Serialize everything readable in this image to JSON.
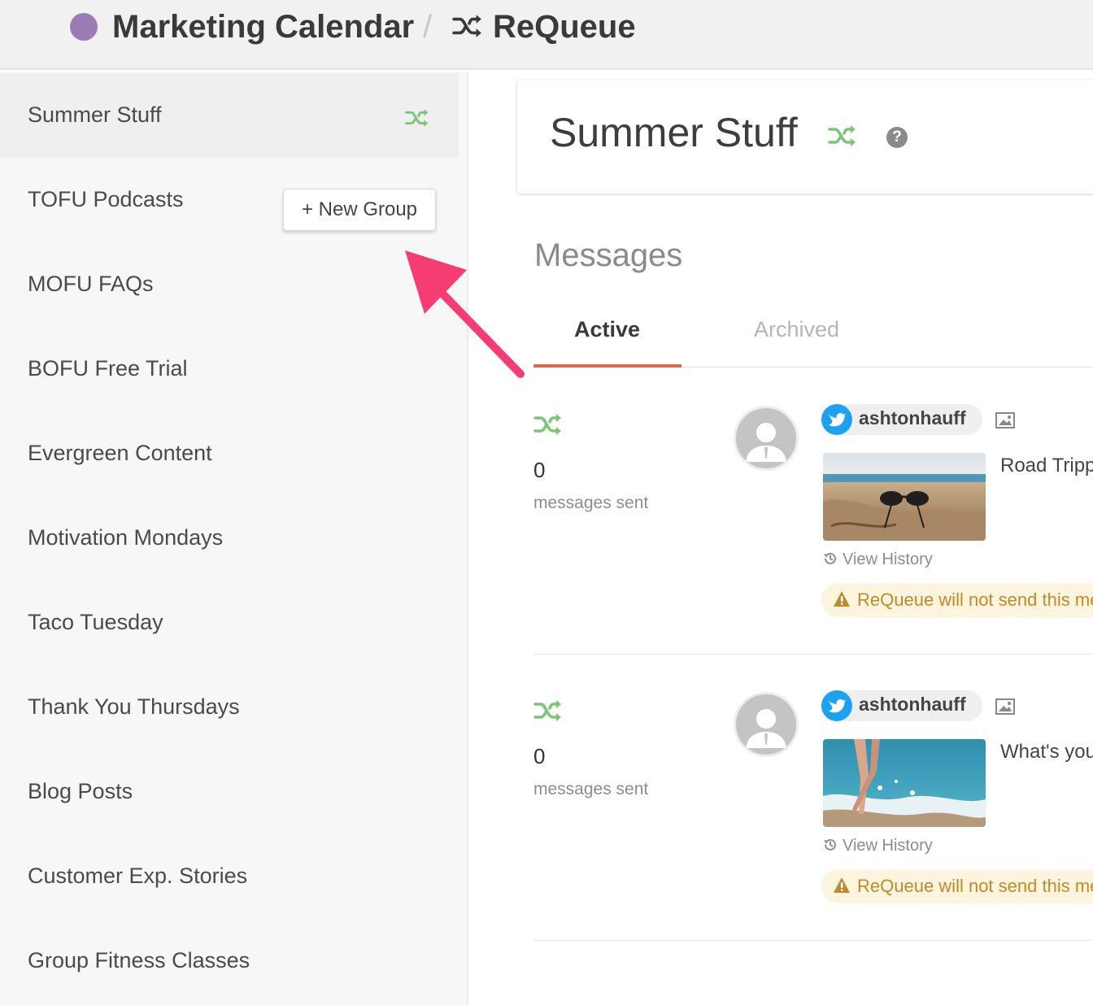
{
  "breadcrumb": {
    "calendar": "Marketing Calendar",
    "separator": "/",
    "section": "ReQueue",
    "dot_color": "#9b7bb1"
  },
  "sidebar": {
    "items": [
      {
        "label": "Summer Stuff",
        "active": true
      },
      {
        "label": "TOFU Podcasts"
      },
      {
        "label": "MOFU FAQs"
      },
      {
        "label": "BOFU Free Trial"
      },
      {
        "label": "Evergreen Content"
      },
      {
        "label": "Motivation Mondays"
      },
      {
        "label": "Taco Tuesday"
      },
      {
        "label": "Thank You Thursdays"
      },
      {
        "label": "Blog Posts"
      },
      {
        "label": "Customer Exp. Stories"
      },
      {
        "label": "Group Fitness Classes"
      }
    ],
    "new_group_label": "+ New Group"
  },
  "main": {
    "title": "Summer Stuff",
    "help": "?",
    "section_title": "Messages",
    "tabs": [
      {
        "label": "Active",
        "active": true
      },
      {
        "label": "Archived"
      }
    ],
    "messages": [
      {
        "count": "0",
        "count_label": "messages sent",
        "username": "ashtonhauff",
        "text": "Road Tripp",
        "history": "View History",
        "warning": "ReQueue will not send this me"
      },
      {
        "count": "0",
        "count_label": "messages sent",
        "username": "ashtonhauff",
        "text": "What's you",
        "history": "View History",
        "warning": "ReQueue will not send this me"
      }
    ]
  },
  "colors": {
    "shuffle_green": "#7cc576",
    "tab_underline": "#d86b4d",
    "arrow_pink": "#f53d74",
    "twitter_blue": "#1da1f2",
    "warning_text": "#bf8a2d"
  },
  "icons": [
    "shuffle-icon",
    "help-icon",
    "twitter-icon",
    "image-icon",
    "history-icon",
    "warning-icon",
    "avatar-icon"
  ]
}
